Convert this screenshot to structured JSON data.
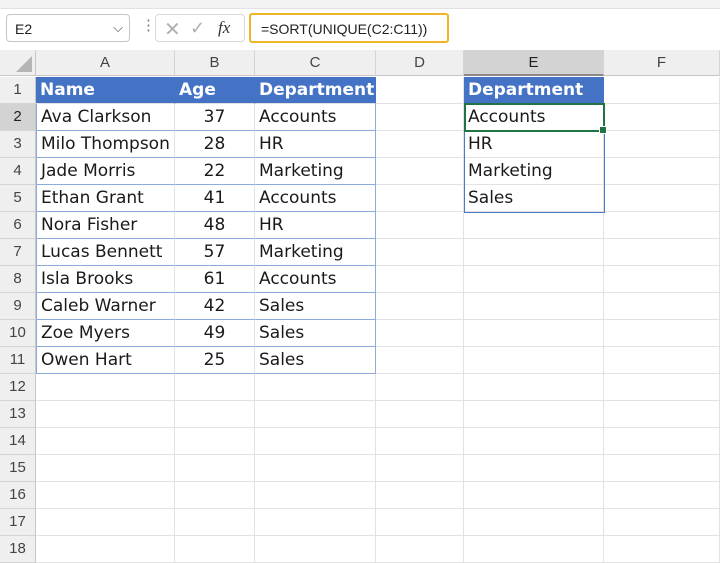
{
  "formula_bar": {
    "name_box": "E2",
    "name_box_icon": "chevron-down-icon",
    "separator": "⋮",
    "cancel_icon": "✕",
    "enter_icon": "✓",
    "fx_label": "fx",
    "formula": "=SORT(UNIQUE(C2:C11))"
  },
  "columns": [
    "A",
    "B",
    "C",
    "D",
    "E",
    "F"
  ],
  "selected_column": "E",
  "rows": [
    "1",
    "2",
    "3",
    "4",
    "5",
    "6",
    "7",
    "8",
    "9",
    "10",
    "11",
    "12",
    "13",
    "14",
    "15",
    "16",
    "17",
    "18"
  ],
  "selected_row": "2",
  "table": {
    "headers": [
      "Name",
      "Age",
      "Department"
    ],
    "records": [
      [
        "Ava Clarkson",
        "37",
        "Accounts"
      ],
      [
        "Milo Thompson",
        "28",
        "HR"
      ],
      [
        "Jade Morris",
        "22",
        "Marketing"
      ],
      [
        "Ethan Grant",
        "41",
        "Accounts"
      ],
      [
        "Nora Fisher",
        "48",
        "HR"
      ],
      [
        "Lucas Bennett",
        "57",
        "Marketing"
      ],
      [
        "Isla Brooks",
        "61",
        "Accounts"
      ],
      [
        "Caleb Warner",
        "42",
        "Sales"
      ],
      [
        "Zoe Myers",
        "49",
        "Sales"
      ],
      [
        "Owen Hart",
        "25",
        "Sales"
      ]
    ]
  },
  "result": {
    "header": "Department",
    "values": [
      "Accounts",
      "HR",
      "Marketing",
      "Sales"
    ]
  },
  "colors": {
    "table_header": "#4472c4",
    "active_cell": "#217346",
    "formula_highlight": "#f0b429"
  }
}
